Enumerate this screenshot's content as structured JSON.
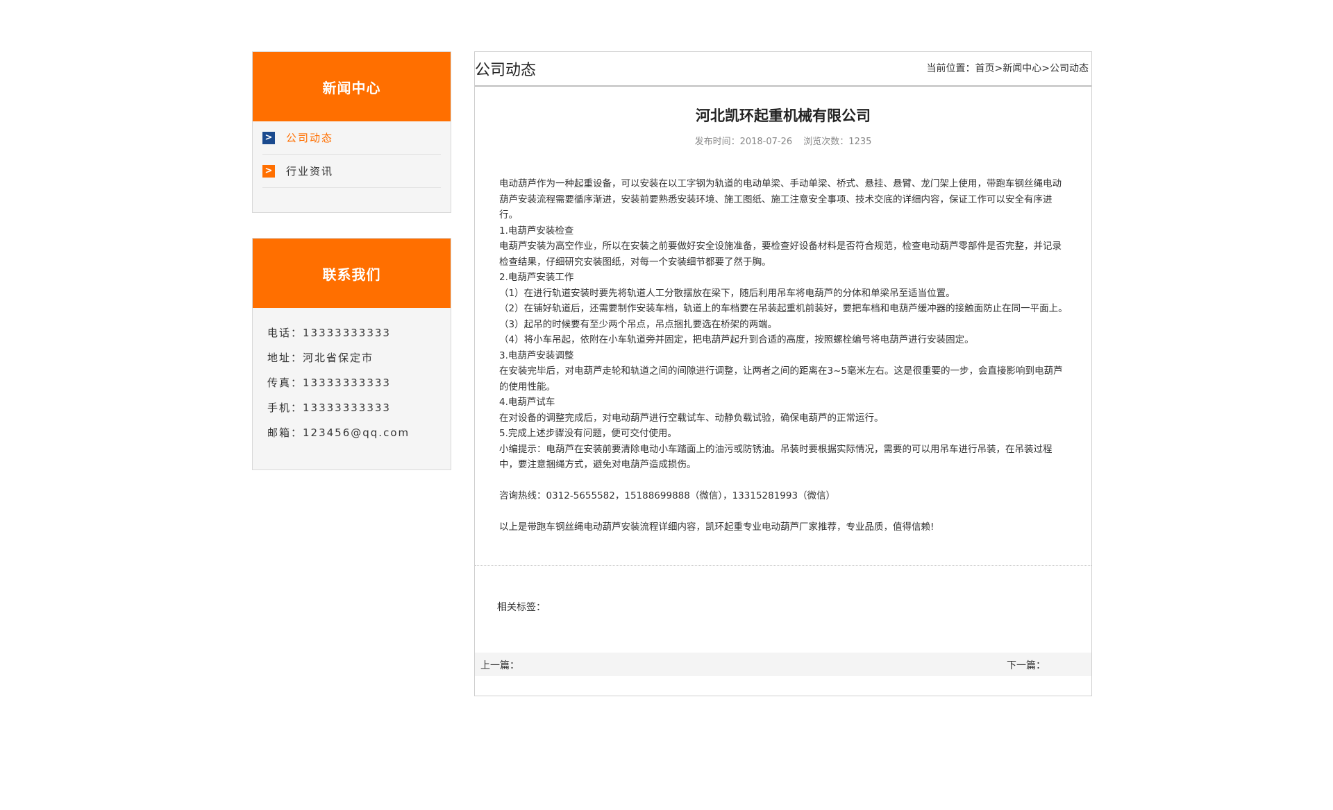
{
  "colors": {
    "accent": "#ff6f00",
    "active_arrow": "#1a4a8e",
    "sidebar_bg": "#f5f5f5"
  },
  "sidebar": {
    "news": {
      "title": "新闻中心",
      "items": [
        {
          "label": "公司动态",
          "icon": "chevron-right-icon",
          "active": true
        },
        {
          "label": "行业资讯",
          "icon": "chevron-right-icon",
          "active": false
        }
      ]
    },
    "contact": {
      "title": "联系我们",
      "rows": [
        "电话：13333333333",
        "地址：河北省保定市",
        "传真：13333333333",
        "手机：13333333333",
        "邮箱：123456@qq.com"
      ]
    }
  },
  "main": {
    "section_title": "公司动态",
    "breadcrumb": {
      "prefix": "当前位置：",
      "items": [
        "首页",
        "新闻中心",
        "公司动态"
      ],
      "separator": ">"
    },
    "article": {
      "title": "河北凯环起重机械有限公司",
      "publish_time": "发布时间：2018-07-26",
      "views": "浏览次数：1235",
      "paragraphs": [
        "电动葫芦作为一种起重设备，可以安装在以工字钢为轨道的电动单梁、手动单梁、桥式、悬挂、悬臂、龙门架上使用，带跑车钢丝绳电动葫芦安装流程需要循序渐进，安装前要熟悉安装环境、施工图纸、施工注意安全事项、技术交底的详细内容，保证工作可以安全有序进行。",
        "1.电葫芦安装检查",
        "电葫芦安装为高空作业，所以在安装之前要做好安全设施准备，要检查好设备材料是否符合规范，检查电动葫芦零部件是否完整，并记录检查结果，仔细研究安装图纸，对每一个安装细节都要了然于胸。",
        "2.电葫芦安装工作",
        "（1）在进行轨道安装时要先将轨道人工分散摆放在梁下，随后利用吊车将电葫芦的分体和单梁吊至适当位置。",
        "（2）在铺好轨道后，还需要制作安装车档，轨道上的车档要在吊装起重机前装好，要把车档和电葫芦缓冲器的接触面防止在同一平面上。",
        "（3）起吊的时候要有至少两个吊点，吊点捆扎要选在桥架的两端。",
        "（4）将小车吊起，依附在小车轨道旁并固定，把电葫芦起升到合适的高度，按照螺栓编号将电葫芦进行安装固定。",
        "3.电葫芦安装调整",
        "在安装完毕后，对电葫芦走轮和轨道之间的间隙进行调整，让两者之间的距离在3~5毫米左右。这是很重要的一步，会直接影响到电葫芦的使用性能。",
        "4.电葫芦试车",
        "在对设备的调整完成后，对电动葫芦进行空载试车、动静负载试验，确保电葫芦的正常运行。",
        "5.完成上述步骤没有问题，便可交付使用。",
        "小编提示：电葫芦在安装前要清除电动小车踏面上的油污或防锈油。吊装时要根据实际情况，需要的可以用吊车进行吊装，在吊装过程中，要注意捆绳方式，避免对电葫芦造成损伤。"
      ],
      "hotline": "咨询热线：0312-5655582，15188699888（微信），13315281993（微信）",
      "closing": "以上是带跑车钢丝绳电动葫芦安装流程详细内容，凯环起重专业电动葫芦厂家推荐，专业品质，值得信赖!"
    },
    "tags_label": "相关标签：",
    "prev_label": "上一篇：",
    "next_label": "下一篇："
  }
}
